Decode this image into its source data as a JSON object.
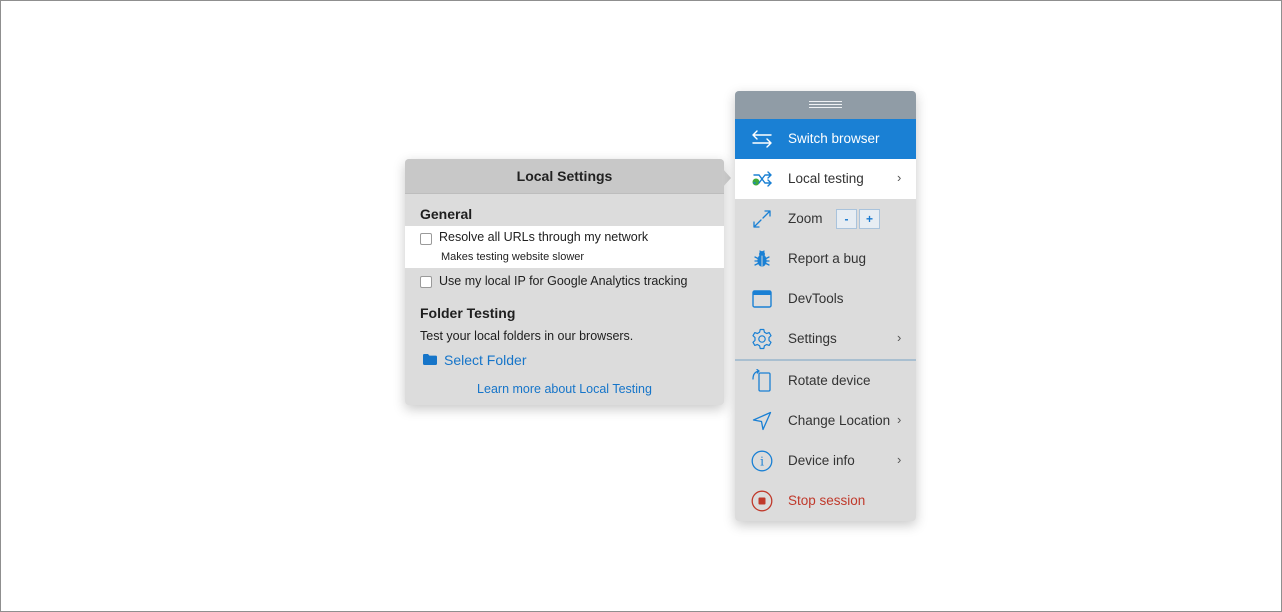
{
  "local_settings": {
    "title": "Local Settings",
    "general_title": "General",
    "option_resolve": {
      "label": "Resolve all URLs through my network",
      "sublabel": "Makes testing website slower",
      "checked": false
    },
    "option_local_ip": {
      "label": "Use my local IP for Google Analytics tracking",
      "checked": false
    },
    "folder_title": "Folder Testing",
    "folder_desc": "Test your local folders in our browsers.",
    "select_folder": "Select Folder",
    "learn_more": "Learn more about Local Testing"
  },
  "menu": {
    "items": [
      {
        "label": "Switch browser",
        "icon": "switch-arrows-icon"
      },
      {
        "label": "Local testing",
        "icon": "local-testing-icon",
        "chevron": "›"
      },
      {
        "label": "Zoom",
        "icon": "expand-arrows-icon",
        "zoom_out": "-",
        "zoom_in": "+"
      },
      {
        "label": "Report a bug",
        "icon": "bug-icon"
      },
      {
        "label": "DevTools",
        "icon": "window-icon"
      },
      {
        "label": "Settings",
        "icon": "gear-icon",
        "chevron": "›"
      },
      {
        "label": "Rotate device",
        "icon": "rotate-device-icon"
      },
      {
        "label": "Change Location",
        "icon": "location-arrow-icon",
        "chevron": "›"
      },
      {
        "label": "Device info",
        "icon": "info-icon",
        "chevron": "›"
      },
      {
        "label": "Stop session",
        "icon": "stop-icon"
      }
    ]
  },
  "colors": {
    "accent": "#1a80d4",
    "link": "#1675c9",
    "danger": "#c0392b",
    "panel_bg": "#dcdcdc",
    "handle_bg": "#909ca6"
  }
}
